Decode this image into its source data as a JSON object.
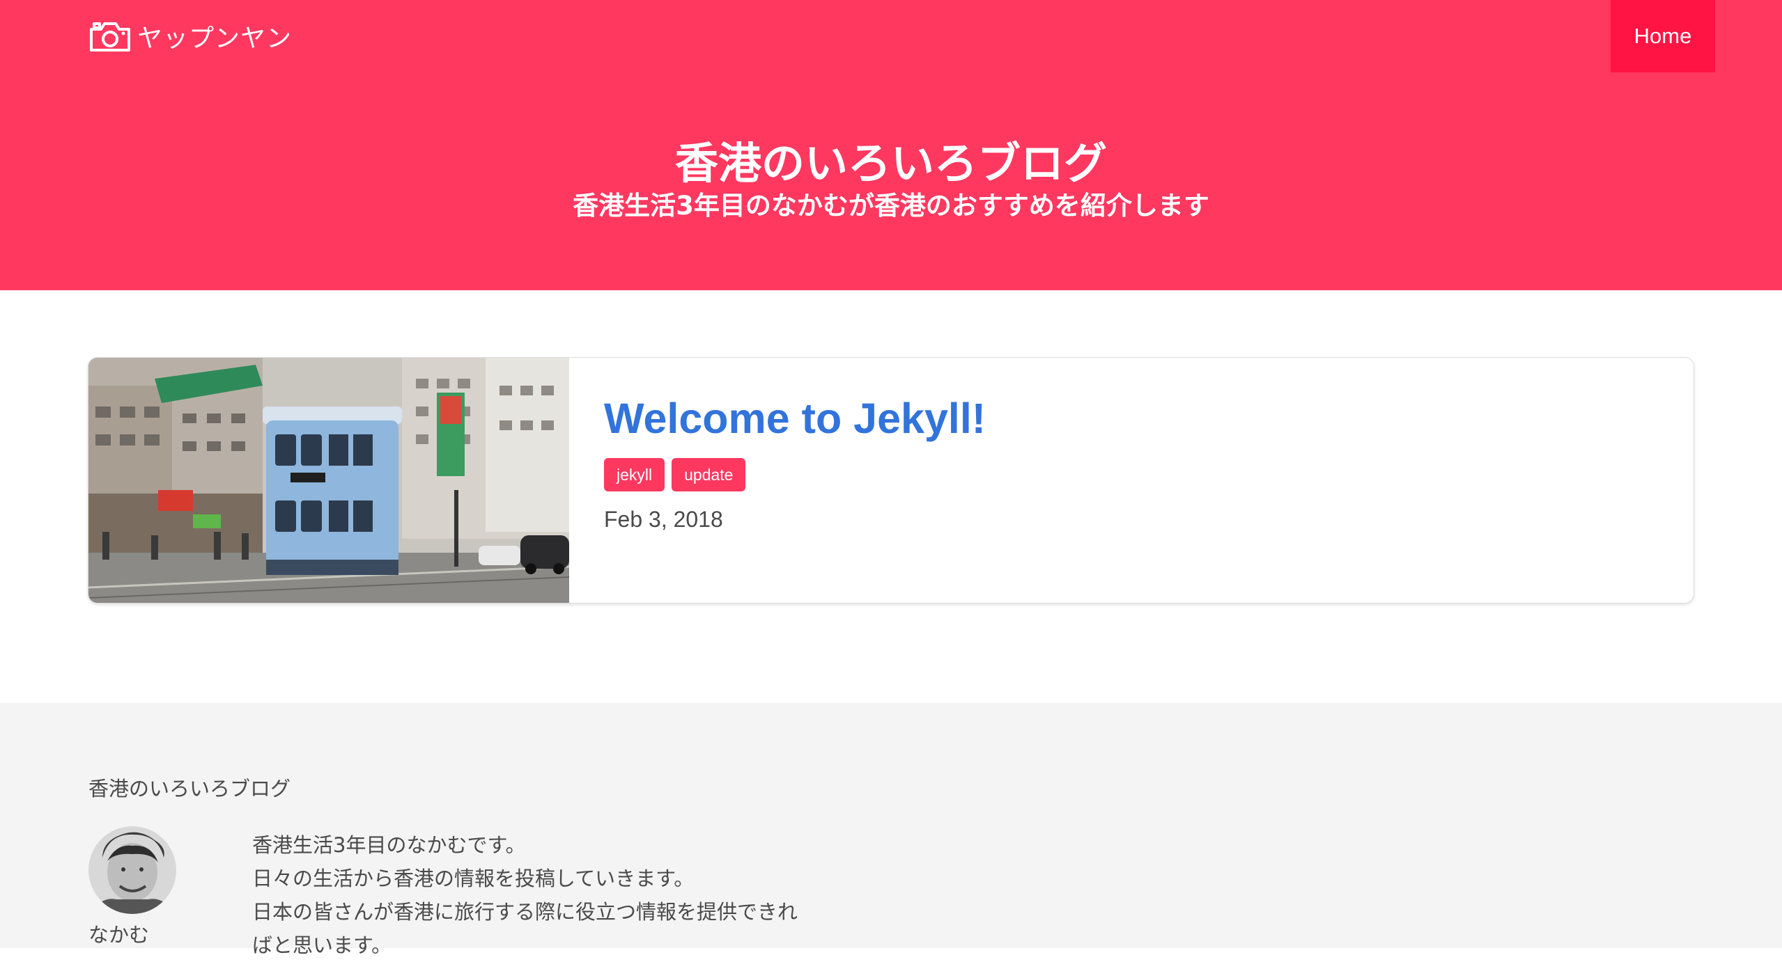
{
  "navbar": {
    "brand_label": "ヤップンヤン",
    "brand_icon": "camera-icon",
    "home_label": "Home"
  },
  "hero": {
    "title": "香港のいろいろブログ",
    "subtitle": "香港生活3年目のなかむが香港のおすすめを紹介します"
  },
  "posts": [
    {
      "title": "Welcome to Jekyll!",
      "tags": [
        "jekyll",
        "update"
      ],
      "date": "Feb 3, 2018",
      "image": "hong-kong-tram-street-photo"
    }
  ],
  "footer": {
    "title": "香港のいろいろブログ",
    "author_name": "なかむ",
    "bio_lines": [
      "香港生活3年目のなかむです。",
      "日々の生活から香港の情報を投稿していきます。",
      "日本の皆さんが香港に旅行する際に役立つ情報を提供できれ",
      "ばと思います。"
    ]
  },
  "colors": {
    "primary": "#ff3860",
    "nav_active": "#ff1443",
    "link": "#3273dc",
    "footer_bg": "#f4f4f4",
    "text": "#4a4a4a"
  }
}
